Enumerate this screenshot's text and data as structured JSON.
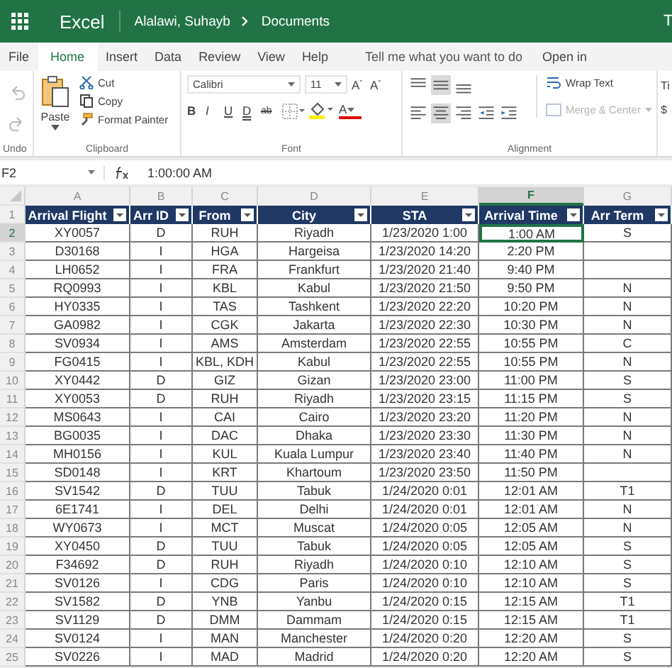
{
  "title_bar": {
    "app": "Excel",
    "breadcrumb": [
      "Alalawi, Suhayb",
      "Documents"
    ],
    "cut_text": "T"
  },
  "menu_tabs": [
    {
      "label": "File",
      "selected": false
    },
    {
      "label": "Home",
      "selected": true
    },
    {
      "label": "Insert",
      "selected": false
    },
    {
      "label": "Data",
      "selected": false
    },
    {
      "label": "Review",
      "selected": false
    },
    {
      "label": "View",
      "selected": false
    },
    {
      "label": "Help",
      "selected": false
    }
  ],
  "tell_me": {
    "placeholder": "Tell me what you want to do"
  },
  "open_in": "Open in",
  "ribbon": {
    "undo": {
      "label": "Undo",
      "undo_disabled": true,
      "redo_disabled": true
    },
    "clipboard": {
      "label": "Clipboard",
      "paste": "Paste",
      "cut": "Cut",
      "copy": "Copy",
      "format_painter": "Format Painter"
    },
    "font": {
      "label": "Font",
      "name": "Calibri",
      "size": "11",
      "grow": "A",
      "grow_mark": "ˆ",
      "shrink": "A",
      "shrink_mark": "ˇ",
      "bold": "B",
      "italic": "I",
      "underline": "U",
      "double_underline": "D",
      "strike": "ab",
      "color_letter": "A"
    },
    "alignment": {
      "label": "Alignment",
      "top": [
        {
          "kind": "top",
          "selected": false
        },
        {
          "kind": "middle",
          "selected": true
        },
        {
          "kind": "bottom",
          "selected": false
        }
      ],
      "bottom": [
        {
          "kind": "left",
          "selected": false
        },
        {
          "kind": "center",
          "selected": true
        },
        {
          "kind": "right",
          "selected": false
        },
        {
          "kind": "outdent",
          "selected": false
        },
        {
          "kind": "indent",
          "selected": false
        }
      ],
      "wrap_text": "Wrap Text",
      "merge": {
        "label": "Merge & Center",
        "disabled": true
      }
    },
    "number": {
      "format_cut": "Ti",
      "currency": "$"
    }
  },
  "formula_bar": {
    "name_box": "F2",
    "value": "1:00:00 AM"
  },
  "sheet": {
    "columns": [
      {
        "letter": "A",
        "selected": false
      },
      {
        "letter": "B",
        "selected": false
      },
      {
        "letter": "C",
        "selected": false
      },
      {
        "letter": "D",
        "selected": false
      },
      {
        "letter": "E",
        "selected": false
      },
      {
        "letter": "F",
        "selected": true
      },
      {
        "letter": "G",
        "selected": false
      }
    ],
    "header_row": {
      "number": "1",
      "cells": [
        "Arrival Flight",
        "Arr ID",
        "From",
        "City",
        "STA",
        "Arrival Time",
        "Arr Term"
      ]
    },
    "rows": [
      {
        "number": "2",
        "selected": true,
        "cells": [
          "XY0057",
          "D",
          "RUH",
          "Riyadh",
          "1/23/2020 1:00",
          "1:00 AM",
          "S"
        ]
      },
      {
        "number": "3",
        "selected": false,
        "cells": [
          "D30168",
          "I",
          "HGA",
          "Hargeisa",
          "1/23/2020 14:20",
          "2:20 PM",
          null
        ]
      },
      {
        "number": "4",
        "selected": false,
        "cells": [
          "LH0652",
          "I",
          "FRA",
          "Frankfurt",
          "1/23/2020 21:40",
          "9:40 PM",
          null
        ]
      },
      {
        "number": "5",
        "selected": false,
        "cells": [
          "RQ0993",
          "I",
          "KBL",
          "Kabul",
          "1/23/2020 21:50",
          "9:50 PM",
          "N"
        ]
      },
      {
        "number": "6",
        "selected": false,
        "cells": [
          "HY0335",
          "I",
          "TAS",
          "Tashkent",
          "1/23/2020 22:20",
          "10:20 PM",
          "N"
        ]
      },
      {
        "number": "7",
        "selected": false,
        "cells": [
          "GA0982",
          "I",
          "CGK",
          "Jakarta",
          "1/23/2020 22:30",
          "10:30 PM",
          "N"
        ]
      },
      {
        "number": "8",
        "selected": false,
        "cells": [
          "SV0934",
          "I",
          "AMS",
          "Amsterdam",
          "1/23/2020 22:55",
          "10:55 PM",
          "C"
        ]
      },
      {
        "number": "9",
        "selected": false,
        "cells": [
          "FG0415",
          "I",
          "KBL, KDH",
          "Kabul",
          "1/23/2020 22:55",
          "10:55 PM",
          "N"
        ]
      },
      {
        "number": "10",
        "selected": false,
        "cells": [
          "XY0442",
          "D",
          "GIZ",
          "Gizan",
          "1/23/2020 23:00",
          "11:00 PM",
          "S"
        ]
      },
      {
        "number": "11",
        "selected": false,
        "cells": [
          "XY0053",
          "D",
          "RUH",
          "Riyadh",
          "1/23/2020 23:15",
          "11:15 PM",
          "S"
        ]
      },
      {
        "number": "12",
        "selected": false,
        "cells": [
          "MS0643",
          "I",
          "CAI",
          "Cairo",
          "1/23/2020 23:20",
          "11:20 PM",
          "N"
        ]
      },
      {
        "number": "13",
        "selected": false,
        "cells": [
          "BG0035",
          "I",
          "DAC",
          "Dhaka",
          "1/23/2020 23:30",
          "11:30 PM",
          "N"
        ]
      },
      {
        "number": "14",
        "selected": false,
        "cells": [
          "MH0156",
          "I",
          "KUL",
          "Kuala Lumpur",
          "1/23/2020 23:40",
          "11:40 PM",
          "N"
        ]
      },
      {
        "number": "15",
        "selected": false,
        "cells": [
          "SD0148",
          "I",
          "KRT",
          "Khartoum",
          "1/23/2020 23:50",
          "11:50 PM",
          null
        ]
      },
      {
        "number": "16",
        "selected": false,
        "cells": [
          "SV1542",
          "D",
          "TUU",
          "Tabuk",
          "1/24/2020 0:01",
          "12:01 AM",
          "T1"
        ]
      },
      {
        "number": "17",
        "selected": false,
        "cells": [
          "6E1741",
          "I",
          "DEL",
          "Delhi",
          "1/24/2020 0:01",
          "12:01 AM",
          "N"
        ]
      },
      {
        "number": "18",
        "selected": false,
        "cells": [
          "WY0673",
          "I",
          "MCT",
          "Muscat",
          "1/24/2020 0:05",
          "12:05 AM",
          "N"
        ]
      },
      {
        "number": "19",
        "selected": false,
        "cells": [
          "XY0450",
          "D",
          "TUU",
          "Tabuk",
          "1/24/2020 0:05",
          "12:05 AM",
          "S"
        ]
      },
      {
        "number": "20",
        "selected": false,
        "cells": [
          "F34692",
          "D",
          "RUH",
          "Riyadh",
          "1/24/2020 0:10",
          "12:10 AM",
          "S"
        ]
      },
      {
        "number": "21",
        "selected": false,
        "cells": [
          "SV0126",
          "I",
          "CDG",
          "Paris",
          "1/24/2020 0:10",
          "12:10 AM",
          "S"
        ]
      },
      {
        "number": "22",
        "selected": false,
        "cells": [
          "SV1582",
          "D",
          "YNB",
          "Yanbu",
          "1/24/2020 0:15",
          "12:15 AM",
          "T1"
        ]
      },
      {
        "number": "23",
        "selected": false,
        "cells": [
          "SV1129",
          "D",
          "DMM",
          "Dammam",
          "1/24/2020 0:15",
          "12:15 AM",
          "T1"
        ]
      },
      {
        "number": "24",
        "selected": false,
        "cells": [
          "SV0124",
          "I",
          "MAN",
          "Manchester",
          "1/24/2020 0:20",
          "12:20 AM",
          "S"
        ]
      },
      {
        "number": "25",
        "selected": false,
        "cells": [
          "SV0226",
          "I",
          "MAD",
          "Madrid",
          "1/24/2020 0:20",
          "12:20 AM",
          "S"
        ]
      }
    ]
  }
}
